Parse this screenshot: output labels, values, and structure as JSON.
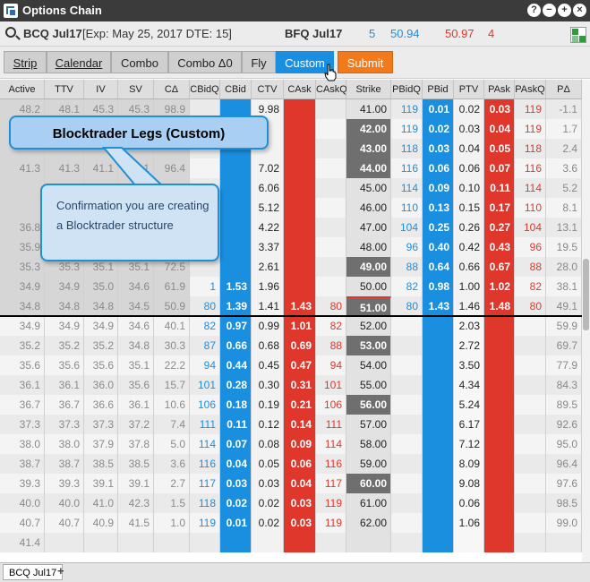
{
  "window": {
    "title": "Options Chain",
    "help": "?",
    "minimize": "−",
    "maximize": "+",
    "close": "×"
  },
  "infobar": {
    "symbol": "BCQ Jul17",
    "expiry": "[Exp: May 25, 2017 DTE: 15]",
    "underlying": "BFQ Jul17",
    "bid_size": "5",
    "bid": "50.94",
    "ask": "50.97",
    "ask_size": "4"
  },
  "tabs": [
    "Strip",
    "Calendar",
    "Combo",
    "Combo Δ0",
    "Fly",
    "Custom",
    "Submit"
  ],
  "columns": [
    "Active",
    "TTV",
    "IV",
    "SV",
    "CΔ",
    "CBidQ",
    "CBid",
    "CTV",
    "CAsk",
    "CAskQ",
    "Strike",
    "PBidQ",
    "PBid",
    "PTV",
    "PAsk",
    "PAskQ",
    "PΔ"
  ],
  "rows": [
    [
      "48.2",
      "48.1",
      "45.3",
      "45.3",
      "98.9",
      "",
      "",
      "9.98",
      "",
      "",
      "41.00",
      "119",
      "0.01",
      "0.02",
      "0.03",
      "119",
      "-1.1"
    ],
    [
      "",
      "",
      "",
      "",
      "",
      "",
      "",
      "",
      "",
      "",
      "42.00",
      "119",
      "0.02",
      "0.03",
      "0.04",
      "119",
      "1.7"
    ],
    [
      "",
      "",
      "",
      "",
      "",
      "",
      "",
      "",
      "",
      "",
      "43.00",
      "118",
      "0.03",
      "0.04",
      "0.05",
      "118",
      "2.4"
    ],
    [
      "41.3",
      "41.3",
      "41.1",
      "41.1",
      "96.4",
      "",
      "",
      "7.02",
      "",
      "",
      "44.00",
      "116",
      "0.06",
      "0.06",
      "0.07",
      "116",
      "3.6"
    ],
    [
      "",
      "",
      "",
      "",
      "",
      "",
      "",
      "6.06",
      "",
      "",
      "45.00",
      "114",
      "0.09",
      "0.10",
      "0.11",
      "114",
      "5.2"
    ],
    [
      "",
      "",
      "",
      "",
      "",
      "",
      "",
      "5.12",
      "",
      "",
      "46.00",
      "110",
      "0.13",
      "0.15",
      "0.17",
      "110",
      "8.1"
    ],
    [
      "36.8",
      "",
      "",
      "",
      "",
      "",
      "",
      "4.22",
      "",
      "",
      "47.00",
      "104",
      "0.25",
      "0.26",
      "0.27",
      "104",
      "13.1"
    ],
    [
      "35.9",
      "",
      "",
      "",
      "",
      "",
      "",
      "3.37",
      "",
      "",
      "48.00",
      "96",
      "0.40",
      "0.42",
      "0.43",
      "96",
      "19.5"
    ],
    [
      "35.3",
      "35.3",
      "35.1",
      "35.1",
      "72.5",
      "",
      "",
      "2.61",
      "",
      "",
      "49.00",
      "88",
      "0.64",
      "0.66",
      "0.67",
      "88",
      "28.0"
    ],
    [
      "34.9",
      "34.9",
      "35.0",
      "34.6",
      "61.9",
      "1",
      "1.53",
      "1.96",
      "",
      "",
      "50.00",
      "82",
      "0.98",
      "1.00",
      "1.02",
      "82",
      "38.1"
    ],
    [
      "34.8",
      "34.8",
      "34.8",
      "34.5",
      "50.9",
      "80",
      "1.39",
      "1.41",
      "1.43",
      "80",
      "51.00",
      "80",
      "1.43",
      "1.46",
      "1.48",
      "80",
      "49.1"
    ],
    [
      "34.9",
      "34.9",
      "34.9",
      "34.6",
      "40.1",
      "82",
      "0.97",
      "0.99",
      "1.01",
      "82",
      "52.00",
      "",
      "",
      "2.03",
      "",
      "",
      "59.9"
    ],
    [
      "35.2",
      "35.2",
      "35.2",
      "34.8",
      "30.3",
      "87",
      "0.66",
      "0.68",
      "0.69",
      "88",
      "53.00",
      "",
      "",
      "2.72",
      "",
      "",
      "69.7"
    ],
    [
      "35.6",
      "35.6",
      "35.6",
      "35.1",
      "22.2",
      "94",
      "0.44",
      "0.45",
      "0.47",
      "94",
      "54.00",
      "",
      "",
      "3.50",
      "",
      "",
      "77.9"
    ],
    [
      "36.1",
      "36.1",
      "36.0",
      "35.6",
      "15.7",
      "101",
      "0.28",
      "0.30",
      "0.31",
      "101",
      "55.00",
      "",
      "",
      "4.34",
      "",
      "",
      "84.3"
    ],
    [
      "36.7",
      "36.7",
      "36.6",
      "36.1",
      "10.6",
      "106",
      "0.18",
      "0.19",
      "0.21",
      "106",
      "56.00",
      "",
      "",
      "5.24",
      "",
      "",
      "89.5"
    ],
    [
      "37.3",
      "37.3",
      "37.3",
      "37.2",
      "7.4",
      "111",
      "0.11",
      "0.12",
      "0.14",
      "111",
      "57.00",
      "",
      "",
      "6.17",
      "",
      "",
      "92.6"
    ],
    [
      "38.0",
      "38.0",
      "37.9",
      "37.8",
      "5.0",
      "114",
      "0.07",
      "0.08",
      "0.09",
      "114",
      "58.00",
      "",
      "",
      "7.12",
      "",
      "",
      "95.0"
    ],
    [
      "38.7",
      "38.7",
      "38.5",
      "38.5",
      "3.6",
      "116",
      "0.04",
      "0.05",
      "0.06",
      "116",
      "59.00",
      "",
      "",
      "8.09",
      "",
      "",
      "96.4"
    ],
    [
      "39.3",
      "39.3",
      "39.1",
      "39.1",
      "2.7",
      "117",
      "0.03",
      "0.03",
      "0.04",
      "117",
      "60.00",
      "",
      "",
      "9.08",
      "",
      "",
      "97.6"
    ],
    [
      "40.0",
      "40.0",
      "41.0",
      "42.3",
      "1.5",
      "118",
      "0.02",
      "0.02",
      "0.03",
      "119",
      "61.00",
      "",
      "",
      "0.06",
      "",
      "",
      "98.5"
    ],
    [
      "40.7",
      "40.7",
      "40.9",
      "41.5",
      "1.0",
      "119",
      "0.01",
      "0.02",
      "0.03",
      "119",
      "62.00",
      "",
      "",
      "1.06",
      "",
      "",
      "99.0"
    ],
    [
      "41.4",
      "",
      "",
      "",
      "",
      "",
      "",
      "",
      "",
      "",
      "",
      "",
      "",
      "",
      "",
      "",
      ""
    ]
  ],
  "callouts": {
    "title": "Blocktrader Legs (Custom)",
    "body": "Confirmation you are creating a Blocktrader structure"
  },
  "bottom_tab": "BCQ Jul17",
  "colors": {
    "blue": "#1a8fe0",
    "red": "#e0372c",
    "dark_strike": "#6f6f6f",
    "orange": "#f27a1a"
  }
}
